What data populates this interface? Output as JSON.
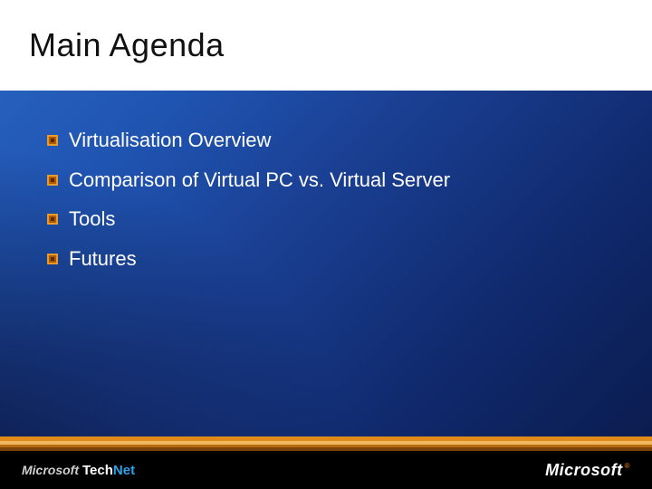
{
  "title": "Main Agenda",
  "bullets": [
    "Virtualisation Overview",
    "Comparison of Virtual PC vs. Virtual Server",
    "Tools",
    "Futures"
  ],
  "footer": {
    "left_logo": {
      "brand": "Microsoft",
      "product_a": "Tech",
      "product_b": "Net"
    },
    "right_logo": {
      "brand": "Microsoft",
      "reg": "®"
    }
  },
  "colors": {
    "accent_orange": "#e08a1a",
    "accent_blue": "#2aa3e8"
  }
}
